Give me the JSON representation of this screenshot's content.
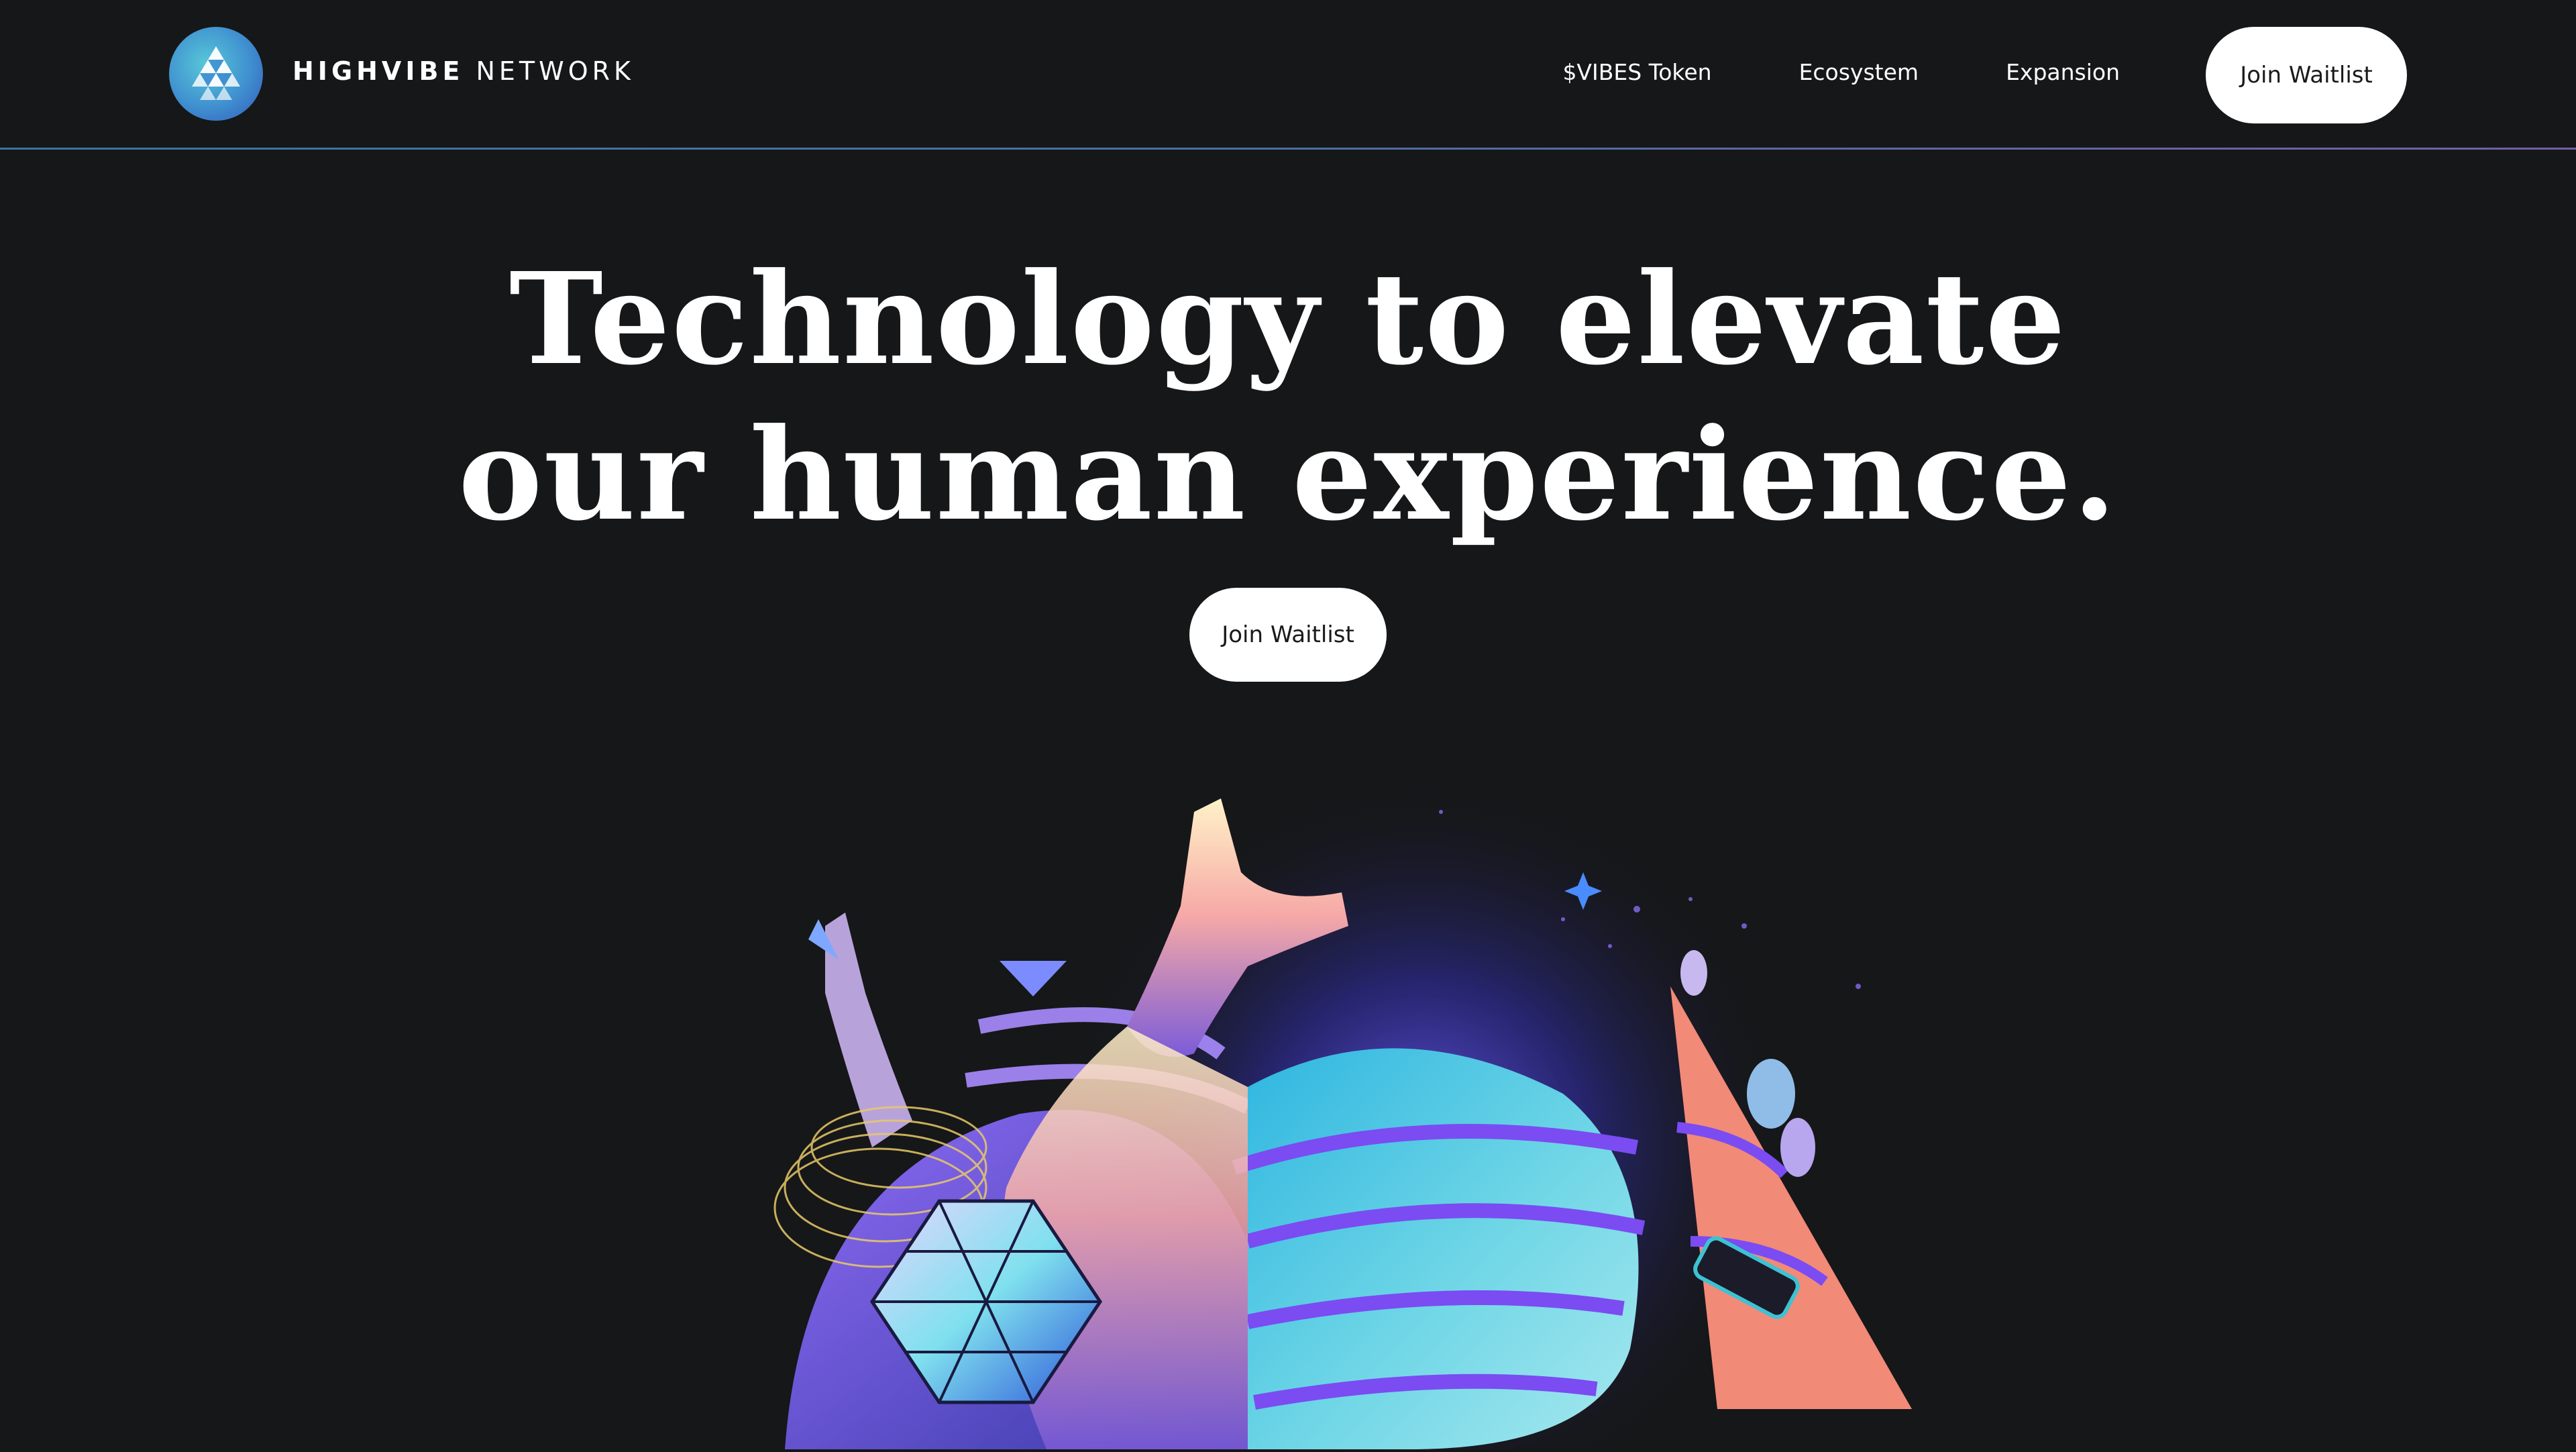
{
  "nav": {
    "brand_bold": "HIGHVIBE",
    "brand_light": "NETWORK",
    "links": [
      "$VIBES Token",
      "Ecosystem",
      "Expansion"
    ],
    "cta": "Join Waitlist"
  },
  "hero": {
    "title_line1": "Technology to elevate",
    "title_line2": "our human experience.",
    "cta": "Join Waitlist"
  },
  "colors": {
    "background": "#161718",
    "accent_teal": "#3fb9d0",
    "accent_purple": "#8a5cf0",
    "accent_coral": "#f28a78"
  },
  "icons": {
    "logo": "triangle-grid-logo-icon"
  }
}
